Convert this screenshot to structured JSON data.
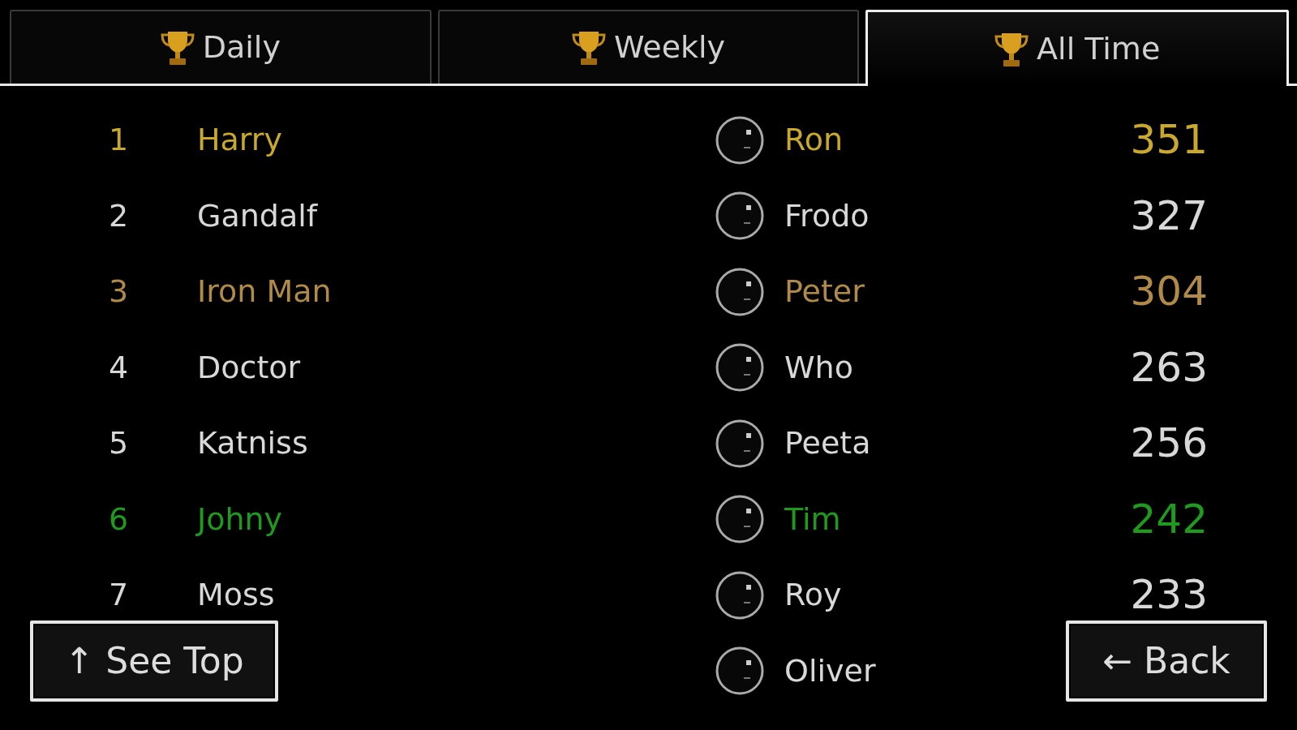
{
  "tabs": [
    {
      "label": "Daily",
      "selected": false
    },
    {
      "label": "Weekly",
      "selected": false
    },
    {
      "label": "All Time",
      "selected": true
    }
  ],
  "rows": [
    {
      "rank": "1",
      "name": "Harry",
      "partner": "Ron",
      "score": "351",
      "color": "#c8a92c"
    },
    {
      "rank": "2",
      "name": "Gandalf",
      "partner": "Frodo",
      "score": "327",
      "color": "#d8d8d8"
    },
    {
      "rank": "3",
      "name": "Iron Man",
      "partner": "Peter",
      "score": "304",
      "color": "#b08a48"
    },
    {
      "rank": "4",
      "name": "Doctor",
      "partner": "Who",
      "score": "263",
      "color": "#d8d8d8"
    },
    {
      "rank": "5",
      "name": "Katniss",
      "partner": "Peeta",
      "score": "256",
      "color": "#d8d8d8"
    },
    {
      "rank": "6",
      "name": "Johny",
      "partner": "Tim",
      "score": "242",
      "color": "#1f9a1f"
    },
    {
      "rank": "7",
      "name": "Moss",
      "partner": "Roy",
      "score": "233",
      "color": "#d8d8d8"
    },
    {
      "partner": "Oliver",
      "color": "#d8d8d8"
    }
  ],
  "buttons": [
    {
      "kind": "top",
      "label": "↑ See Top"
    },
    {
      "kind": "back",
      "label": "← Back"
    }
  ]
}
